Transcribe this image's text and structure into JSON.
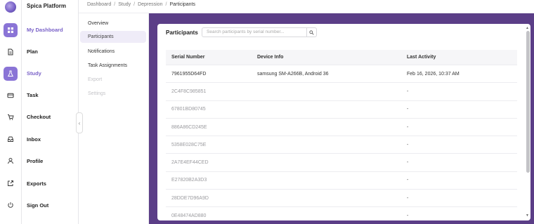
{
  "app": {
    "name": "Spica Platform"
  },
  "nav": [
    {
      "label": "My Dashboard",
      "icon": "grid-icon",
      "active": true
    },
    {
      "label": "Plan",
      "icon": "document-icon",
      "active": false
    },
    {
      "label": "Study",
      "icon": "flask-icon",
      "active": true
    },
    {
      "label": "Task",
      "icon": "card-icon",
      "active": false
    },
    {
      "label": "Checkout",
      "icon": "cart-icon",
      "active": false
    },
    {
      "label": "Inbox",
      "icon": "inbox-icon",
      "active": false
    },
    {
      "label": "Profile",
      "icon": "user-icon",
      "active": false
    },
    {
      "label": "Exports",
      "icon": "export-icon",
      "active": false
    },
    {
      "label": "Sign Out",
      "icon": "power-icon",
      "active": false
    }
  ],
  "breadcrumb": [
    "Dashboard",
    "Study",
    "Depression",
    "Participants"
  ],
  "subnav": [
    {
      "label": "Overview",
      "state": "normal"
    },
    {
      "label": "Participants",
      "state": "active"
    },
    {
      "label": "Notifications",
      "state": "normal"
    },
    {
      "label": "Task Assignments",
      "state": "normal"
    },
    {
      "label": "Export",
      "state": "disabled"
    },
    {
      "label": "Settings",
      "state": "disabled"
    }
  ],
  "participants": {
    "title": "Participants",
    "search_placeholder": "Search participants by serial number...",
    "columns": [
      "Serial Number",
      "Device Info",
      "Last Activity"
    ],
    "rows": [
      {
        "serial": "7961955D64FD",
        "device": "samsung SM-A266B, Android 36",
        "last": "Feb 16, 2026, 10:37 AM"
      },
      {
        "serial": "2C4F8C985851",
        "device": "",
        "last": "-"
      },
      {
        "serial": "67801BD80745",
        "device": "",
        "last": "-"
      },
      {
        "serial": "886A86CD245E",
        "device": "",
        "last": "-"
      },
      {
        "serial": "5358E028C75E",
        "device": "",
        "last": "-"
      },
      {
        "serial": "2A7E4EF44CED",
        "device": "",
        "last": "-"
      },
      {
        "serial": "E27820B2A3D3",
        "device": "",
        "last": "-"
      },
      {
        "serial": "28DDE7D96A9D",
        "device": "",
        "last": "-"
      },
      {
        "serial": "0E48474AD880",
        "device": "",
        "last": "-"
      }
    ]
  },
  "colors": {
    "accent": "#8a74d6",
    "panel": "#5b3e87"
  }
}
